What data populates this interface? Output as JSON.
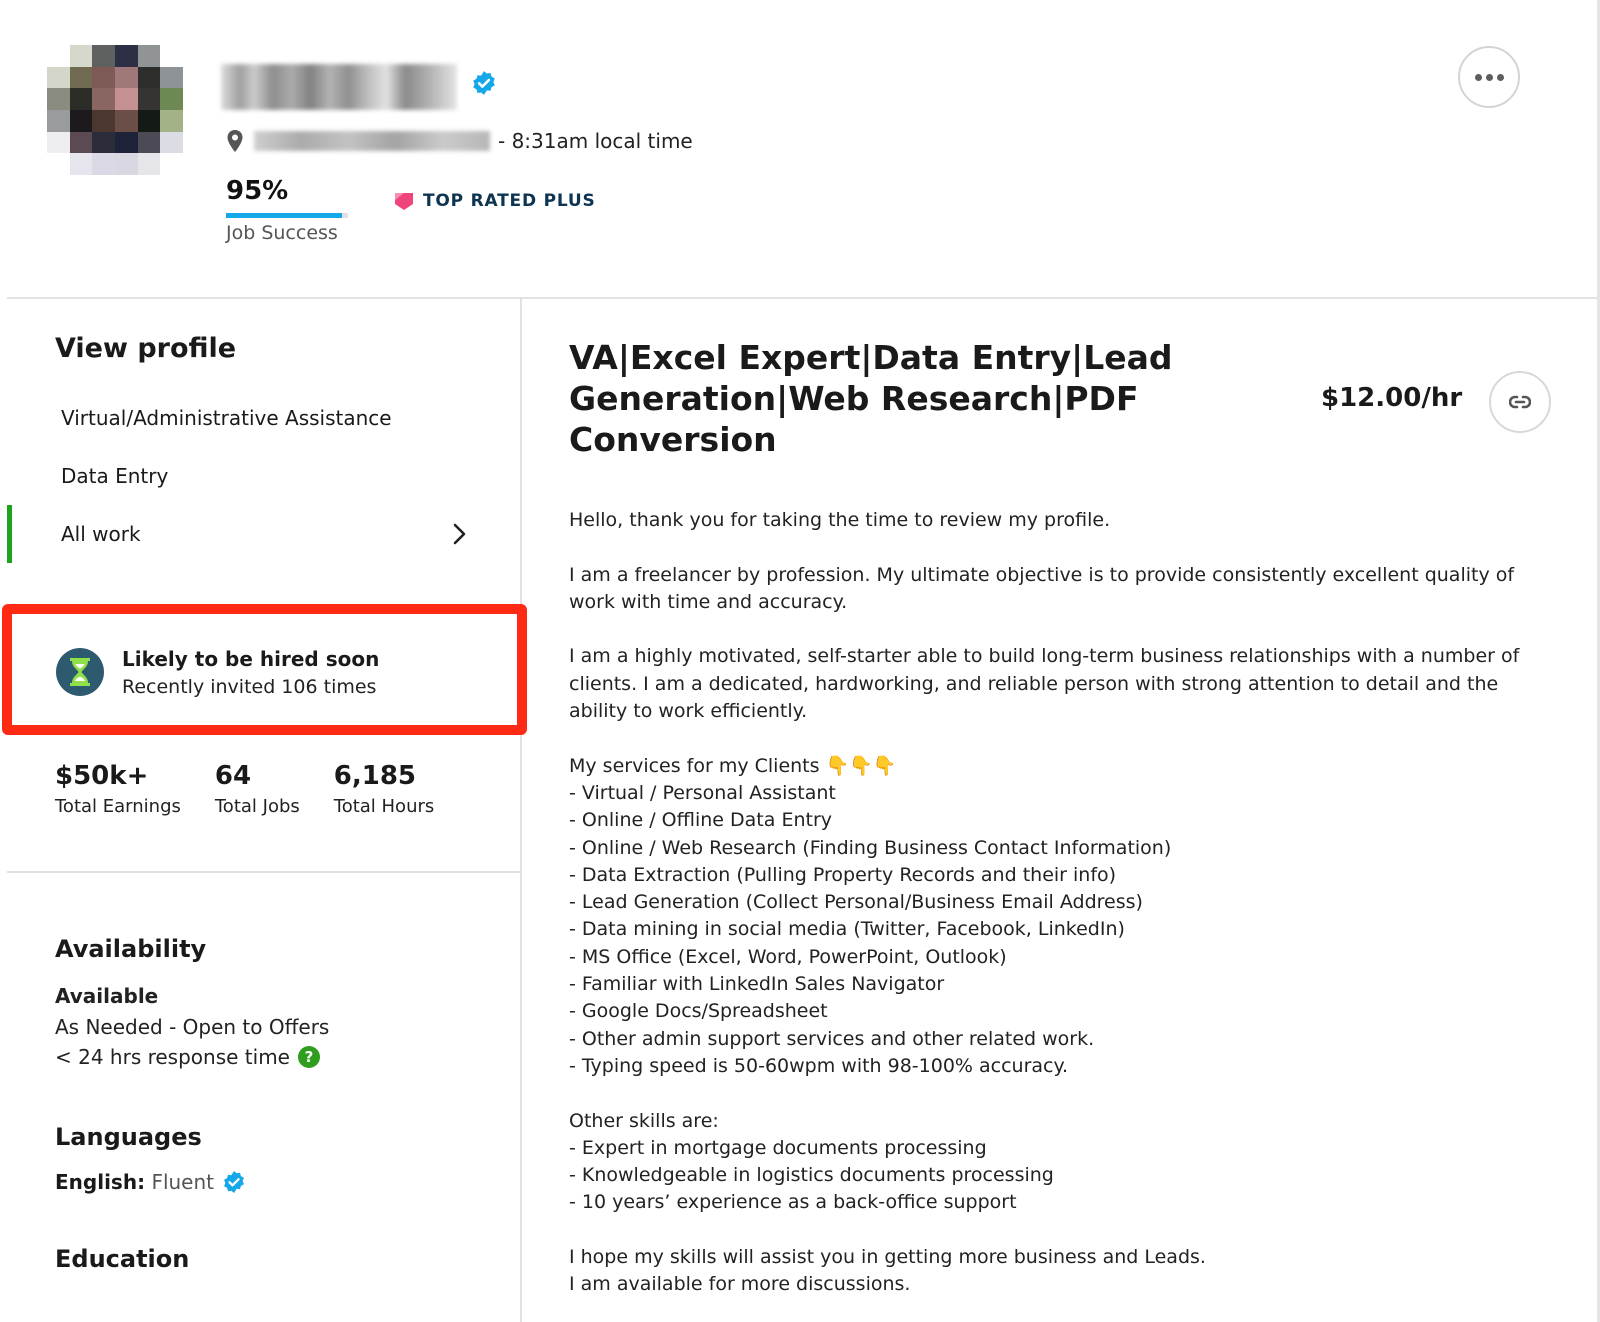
{
  "header": {
    "name": "[name redacted]",
    "location": "[location redacted]",
    "local_time": "- 8:31am local time",
    "job_success": {
      "value": "95%",
      "fraction": 0.95,
      "label": "Job Success"
    },
    "badge": "TOP RATED PLUS",
    "more_button_label": "More options"
  },
  "sidebar": {
    "heading": "View profile",
    "nav_items": [
      {
        "label": "Virtual/Administrative Assistance",
        "active": false
      },
      {
        "label": "Data Entry",
        "active": false
      },
      {
        "label": "All work",
        "active": true
      }
    ],
    "hire_notice": {
      "title": "Likely to be hired soon",
      "subtitle": "Recently invited 106 times"
    },
    "stats": [
      {
        "value": "$50k+",
        "label": "Total Earnings"
      },
      {
        "value": "64",
        "label": "Total Jobs"
      },
      {
        "value": "6,185",
        "label": "Total Hours"
      }
    ],
    "availability": {
      "heading": "Availability",
      "status": "Available",
      "schedule": "As Needed - Open to Offers",
      "response_time": "< 24 hrs response time"
    },
    "languages": {
      "heading": "Languages",
      "items": [
        {
          "language": "English:",
          "level": "Fluent"
        }
      ]
    },
    "education": {
      "heading": "Education"
    }
  },
  "main": {
    "title": "VA|Excel Expert|Data Entry|Lead Generation|Web Research|PDF Conversion",
    "rate": "$12.00/hr",
    "overview": [
      [
        "Hello, thank you for taking the time to review my profile."
      ],
      [
        "I am a freelancer by profession. My ultimate objective is to provide consistently excellent quality of work with time and accuracy."
      ],
      [
        "I am a highly motivated, self-starter able to build long-term business relationships with a number of clients. I am a dedicated, hardworking, and reliable person with strong attention to detail and the ability to work efficiently."
      ],
      [
        "My services for my Clients 👇👇👇",
        "- Virtual / Personal Assistant",
        "- Online / Offline Data Entry",
        "- Online / Web Research (Finding Business Contact Information)",
        "- Data Extraction (Pulling Property Records and their info)",
        "- Lead Generation (Collect Personal/Business Email Address)",
        "- Data mining in social media (Twitter, Facebook, LinkedIn)",
        "- MS Office (Excel, Word, PowerPoint, Outlook)",
        "- Familiar with LinkedIn Sales Navigator",
        "- Google Docs/Spreadsheet",
        "- Other admin support services and other related work.",
        "- Typing speed is 50-60wpm with 98-100% accuracy."
      ],
      [
        "Other skills are:",
        "- Expert in mortgage documents processing",
        "- Knowledgeable in logistics documents processing",
        "- 10 years’ experience as a back-office support"
      ],
      [
        "I hope my skills will assist you in getting more business and Leads.",
        "I am available for more discussions."
      ]
    ]
  },
  "colors": {
    "accent_green": "#1ea31c",
    "highlight_red": "#ff2a14",
    "verified_blue": "#14a8e8",
    "badge_pink": "#f0457a",
    "hourglass_bg": "#2e5a70",
    "hourglass_fg": "#8fe04a"
  }
}
